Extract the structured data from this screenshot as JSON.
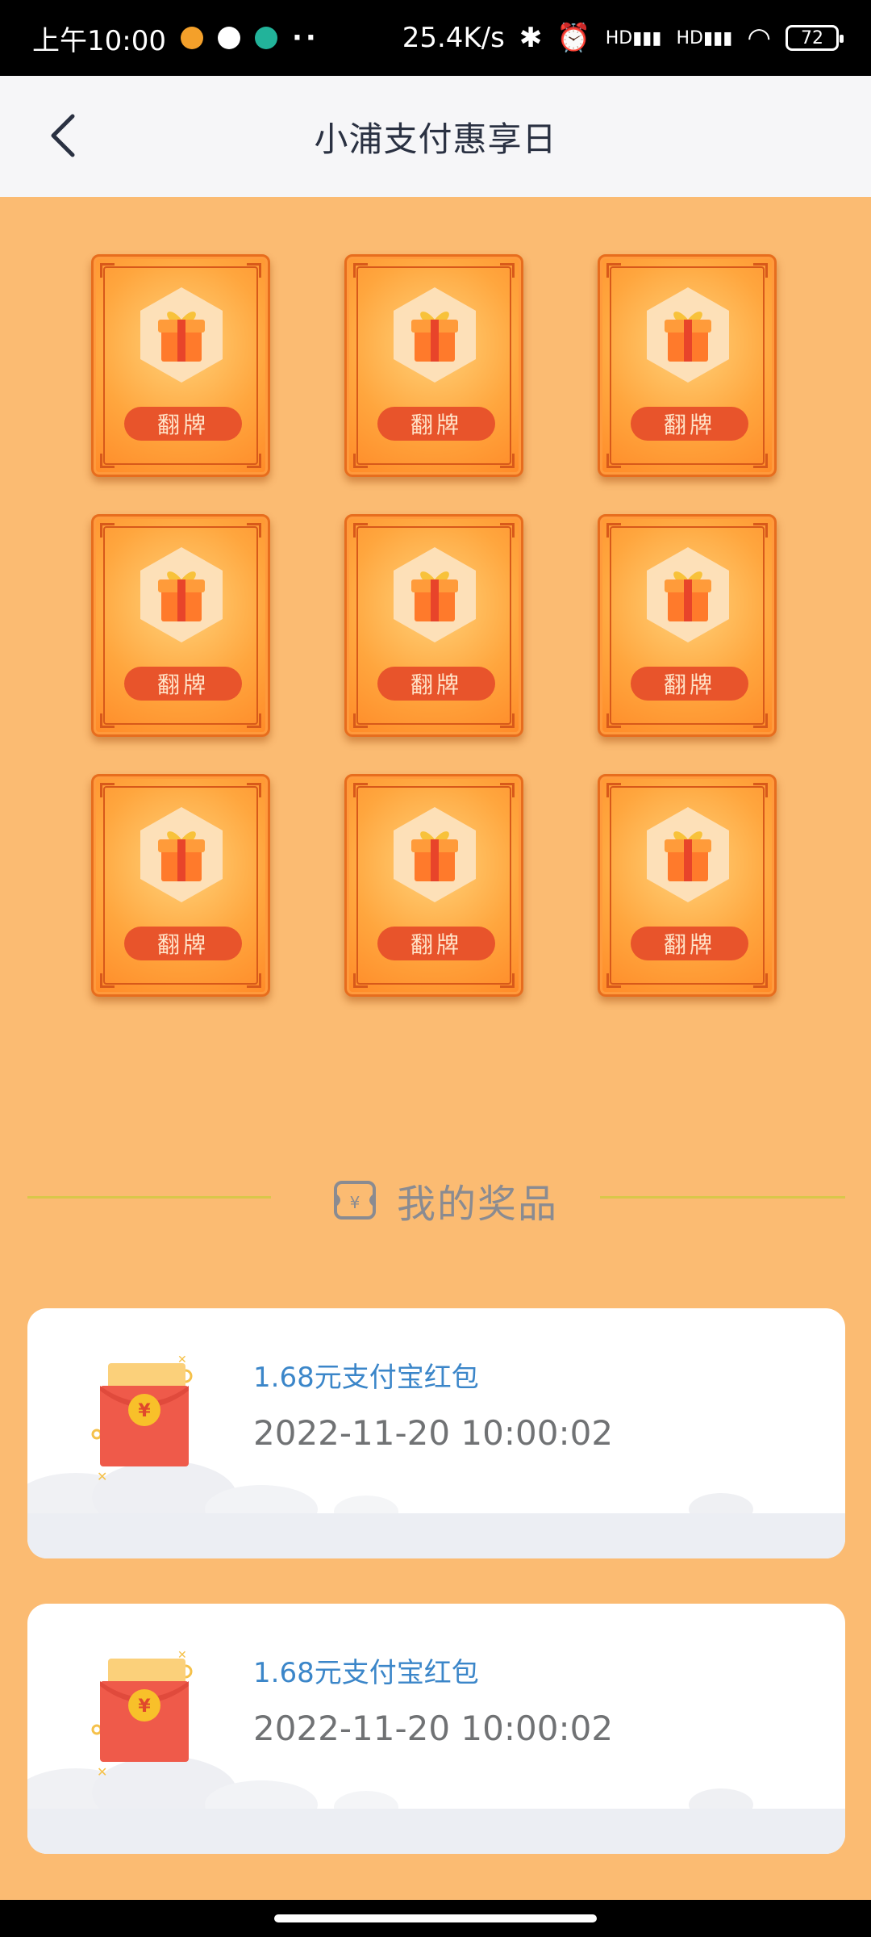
{
  "status_bar": {
    "time": "上午10:00",
    "more": "··",
    "network_speed": "25.4K/s",
    "signal_1": "HD",
    "signal_2": "HD",
    "battery": "72"
  },
  "header": {
    "title": "小浦支付惠享日"
  },
  "cards": [
    {
      "label": "翻牌"
    },
    {
      "label": "翻牌"
    },
    {
      "label": "翻牌"
    },
    {
      "label": "翻牌"
    },
    {
      "label": "翻牌"
    },
    {
      "label": "翻牌"
    },
    {
      "label": "翻牌"
    },
    {
      "label": "翻牌"
    },
    {
      "label": "翻牌"
    }
  ],
  "prizes_section": {
    "title": "我的奖品"
  },
  "prizes": [
    {
      "name": "1.68元支付宝红包",
      "time": "2022-11-20 10:00:02"
    },
    {
      "name": "1.68元支付宝红包",
      "time": "2022-11-20 10:00:02"
    }
  ],
  "colors": {
    "background": "#fbbb72",
    "card_orange": "#ff8a28",
    "flip_button": "#e8542b",
    "prize_name": "#3b86c9"
  },
  "icons": [
    "back-arrow-icon",
    "gift-icon",
    "prize-ticket-icon",
    "red-envelope-icon",
    "bluetooth-icon",
    "alarm-icon",
    "wifi-icon",
    "battery-icon"
  ]
}
